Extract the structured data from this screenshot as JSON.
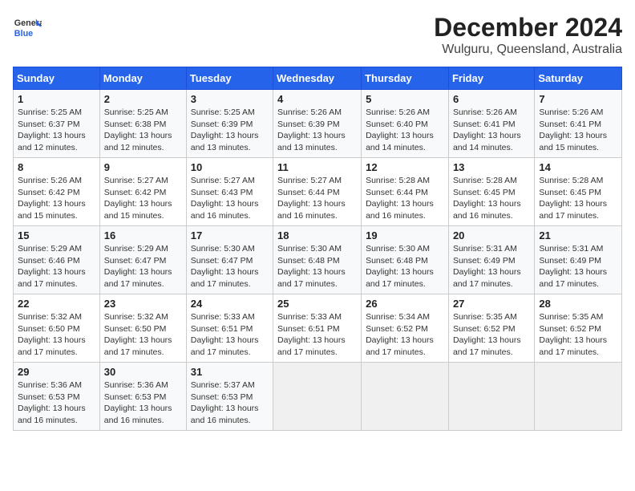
{
  "logo": {
    "general": "General",
    "blue": "Blue"
  },
  "title": "December 2024",
  "subtitle": "Wulguru, Queensland, Australia",
  "weekdays": [
    "Sunday",
    "Monday",
    "Tuesday",
    "Wednesday",
    "Thursday",
    "Friday",
    "Saturday"
  ],
  "weeks": [
    [
      {
        "day": 1,
        "sunrise": "5:25 AM",
        "sunset": "6:37 PM",
        "daylight": "13 hours and 12 minutes."
      },
      {
        "day": 2,
        "sunrise": "5:25 AM",
        "sunset": "6:38 PM",
        "daylight": "13 hours and 12 minutes."
      },
      {
        "day": 3,
        "sunrise": "5:25 AM",
        "sunset": "6:39 PM",
        "daylight": "13 hours and 13 minutes."
      },
      {
        "day": 4,
        "sunrise": "5:26 AM",
        "sunset": "6:39 PM",
        "daylight": "13 hours and 13 minutes."
      },
      {
        "day": 5,
        "sunrise": "5:26 AM",
        "sunset": "6:40 PM",
        "daylight": "13 hours and 14 minutes."
      },
      {
        "day": 6,
        "sunrise": "5:26 AM",
        "sunset": "6:41 PM",
        "daylight": "13 hours and 14 minutes."
      },
      {
        "day": 7,
        "sunrise": "5:26 AM",
        "sunset": "6:41 PM",
        "daylight": "13 hours and 15 minutes."
      }
    ],
    [
      {
        "day": 8,
        "sunrise": "5:26 AM",
        "sunset": "6:42 PM",
        "daylight": "13 hours and 15 minutes."
      },
      {
        "day": 9,
        "sunrise": "5:27 AM",
        "sunset": "6:42 PM",
        "daylight": "13 hours and 15 minutes."
      },
      {
        "day": 10,
        "sunrise": "5:27 AM",
        "sunset": "6:43 PM",
        "daylight": "13 hours and 16 minutes."
      },
      {
        "day": 11,
        "sunrise": "5:27 AM",
        "sunset": "6:44 PM",
        "daylight": "13 hours and 16 minutes."
      },
      {
        "day": 12,
        "sunrise": "5:28 AM",
        "sunset": "6:44 PM",
        "daylight": "13 hours and 16 minutes."
      },
      {
        "day": 13,
        "sunrise": "5:28 AM",
        "sunset": "6:45 PM",
        "daylight": "13 hours and 16 minutes."
      },
      {
        "day": 14,
        "sunrise": "5:28 AM",
        "sunset": "6:45 PM",
        "daylight": "13 hours and 17 minutes."
      }
    ],
    [
      {
        "day": 15,
        "sunrise": "5:29 AM",
        "sunset": "6:46 PM",
        "daylight": "13 hours and 17 minutes."
      },
      {
        "day": 16,
        "sunrise": "5:29 AM",
        "sunset": "6:47 PM",
        "daylight": "13 hours and 17 minutes."
      },
      {
        "day": 17,
        "sunrise": "5:30 AM",
        "sunset": "6:47 PM",
        "daylight": "13 hours and 17 minutes."
      },
      {
        "day": 18,
        "sunrise": "5:30 AM",
        "sunset": "6:48 PM",
        "daylight": "13 hours and 17 minutes."
      },
      {
        "day": 19,
        "sunrise": "5:30 AM",
        "sunset": "6:48 PM",
        "daylight": "13 hours and 17 minutes."
      },
      {
        "day": 20,
        "sunrise": "5:31 AM",
        "sunset": "6:49 PM",
        "daylight": "13 hours and 17 minutes."
      },
      {
        "day": 21,
        "sunrise": "5:31 AM",
        "sunset": "6:49 PM",
        "daylight": "13 hours and 17 minutes."
      }
    ],
    [
      {
        "day": 22,
        "sunrise": "5:32 AM",
        "sunset": "6:50 PM",
        "daylight": "13 hours and 17 minutes."
      },
      {
        "day": 23,
        "sunrise": "5:32 AM",
        "sunset": "6:50 PM",
        "daylight": "13 hours and 17 minutes."
      },
      {
        "day": 24,
        "sunrise": "5:33 AM",
        "sunset": "6:51 PM",
        "daylight": "13 hours and 17 minutes."
      },
      {
        "day": 25,
        "sunrise": "5:33 AM",
        "sunset": "6:51 PM",
        "daylight": "13 hours and 17 minutes."
      },
      {
        "day": 26,
        "sunrise": "5:34 AM",
        "sunset": "6:52 PM",
        "daylight": "13 hours and 17 minutes."
      },
      {
        "day": 27,
        "sunrise": "5:35 AM",
        "sunset": "6:52 PM",
        "daylight": "13 hours and 17 minutes."
      },
      {
        "day": 28,
        "sunrise": "5:35 AM",
        "sunset": "6:52 PM",
        "daylight": "13 hours and 17 minutes."
      }
    ],
    [
      {
        "day": 29,
        "sunrise": "5:36 AM",
        "sunset": "6:53 PM",
        "daylight": "13 hours and 16 minutes."
      },
      {
        "day": 30,
        "sunrise": "5:36 AM",
        "sunset": "6:53 PM",
        "daylight": "13 hours and 16 minutes."
      },
      {
        "day": 31,
        "sunrise": "5:37 AM",
        "sunset": "6:53 PM",
        "daylight": "13 hours and 16 minutes."
      },
      null,
      null,
      null,
      null
    ]
  ]
}
